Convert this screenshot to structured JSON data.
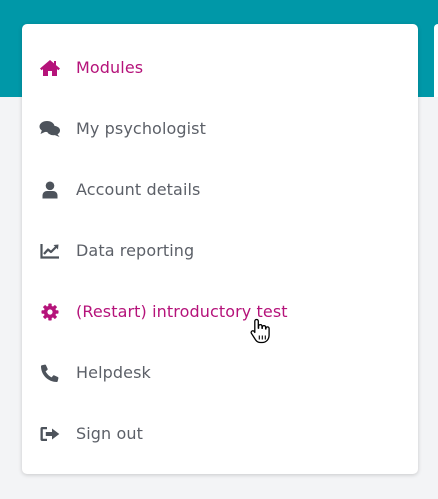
{
  "colors": {
    "header": "#0098a8",
    "active": "#b5137a",
    "default_text": "#5c6068",
    "icon_default": "#4d535b"
  },
  "menu": {
    "items": [
      {
        "label": "Modules",
        "icon": "home-icon",
        "active": true
      },
      {
        "label": "My psychologist",
        "icon": "chat-icon",
        "active": false
      },
      {
        "label": "Account details",
        "icon": "user-icon",
        "active": false
      },
      {
        "label": "Data reporting",
        "icon": "chart-line-icon",
        "active": false
      },
      {
        "label": "(Restart) introductory test",
        "icon": "gear-icon",
        "active": true
      },
      {
        "label": "Helpdesk",
        "icon": "phone-icon",
        "active": false
      },
      {
        "label": "Sign out",
        "icon": "sign-out-icon",
        "active": false
      }
    ]
  }
}
